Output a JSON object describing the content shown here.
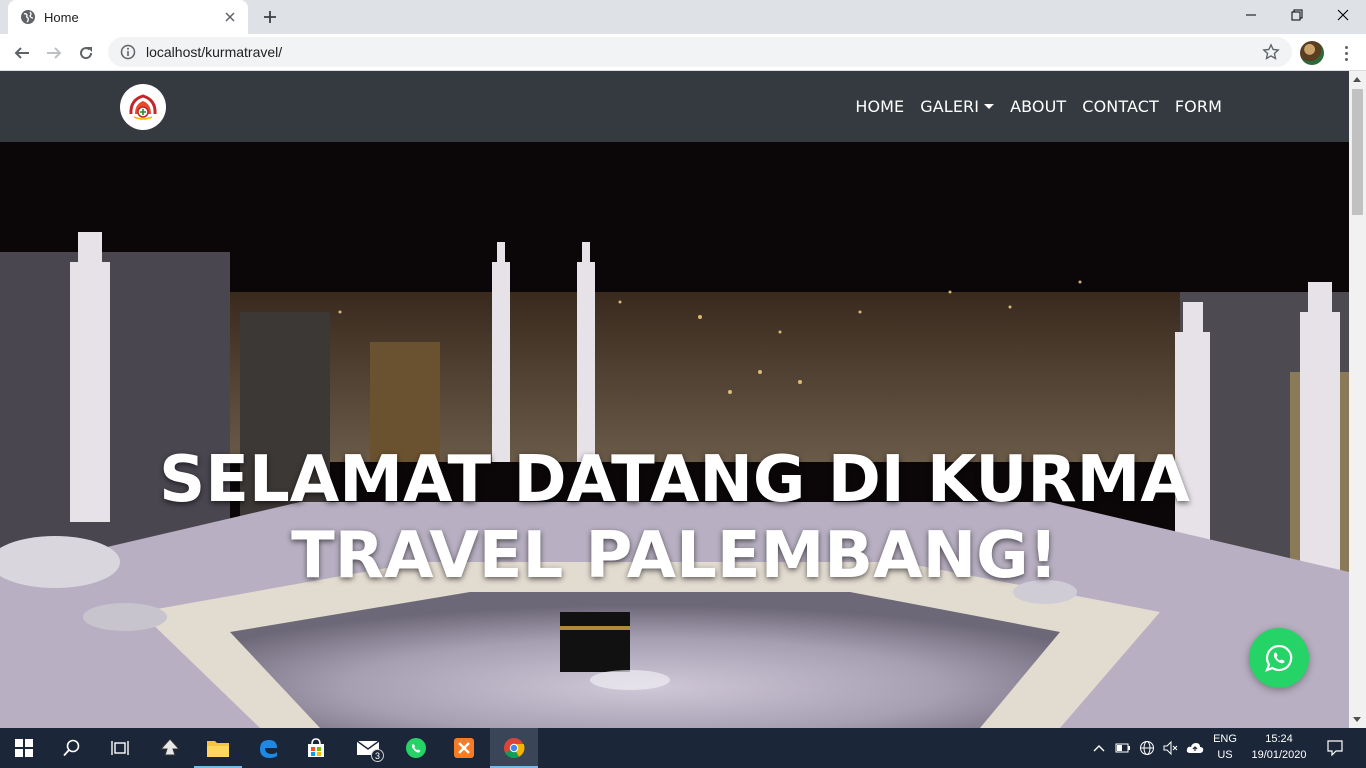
{
  "browser": {
    "tab_title": "Home",
    "url": "localhost/kurmatravel/"
  },
  "site": {
    "nav": [
      {
        "label": "HOME"
      },
      {
        "label": "GALERI",
        "dropdown": true
      },
      {
        "label": "ABOUT"
      },
      {
        "label": "CONTACT"
      },
      {
        "label": "FORM"
      }
    ],
    "hero_title": "SELAMAT DATANG DI KURMA TRAVEL PALEMBANG!",
    "nav_bg": "#343a40",
    "whatsapp_color": "#25d366"
  },
  "taskbar": {
    "mail_badge": "3",
    "lang_line1": "ENG",
    "lang_line2": "US",
    "time": "15:24",
    "date": "19/01/2020",
    "bg": "#1b2738"
  }
}
